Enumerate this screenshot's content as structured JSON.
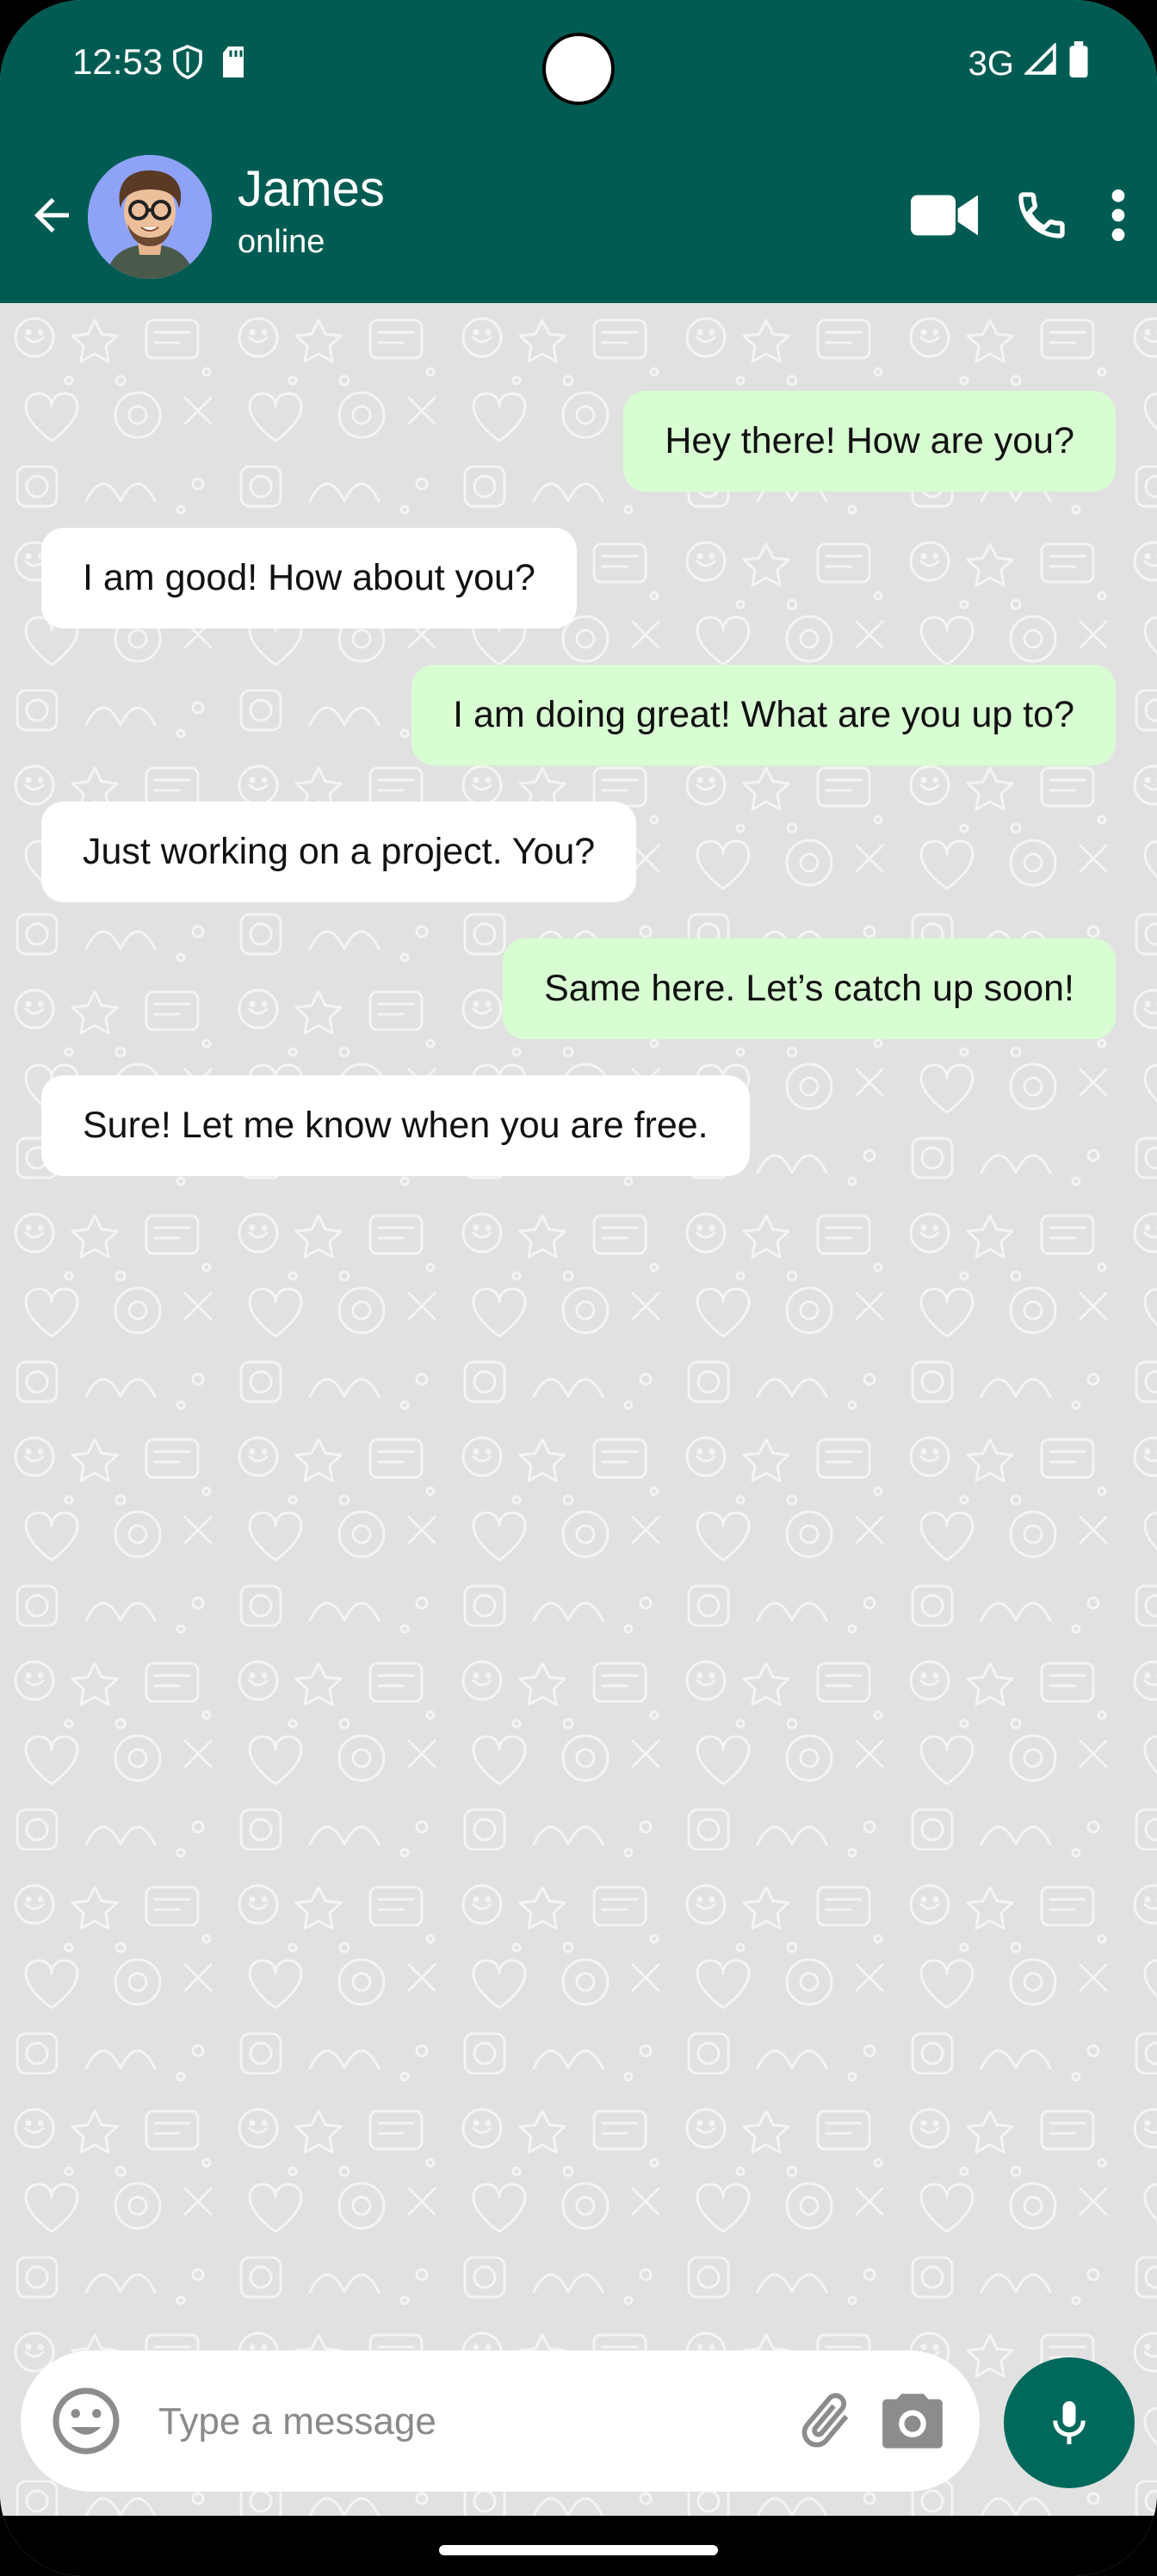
{
  "status": {
    "time": "12:53",
    "network": "3G",
    "icons": [
      "shield-icon",
      "sd-card-icon",
      "signal-icon",
      "battery-icon"
    ]
  },
  "header": {
    "name": "James",
    "status": "online",
    "actions": [
      "video-call-icon",
      "phone-call-icon",
      "more-vert-icon"
    ],
    "color": "#005c53"
  },
  "messages": [
    {
      "direction": "out",
      "text": "Hey there! How are you?"
    },
    {
      "direction": "in",
      "text": "I am good! How about you?"
    },
    {
      "direction": "out",
      "text": "I am doing great! What are you up to?"
    },
    {
      "direction": "in",
      "text": "Just working on a project. You?"
    },
    {
      "direction": "out",
      "text": "Same here. Let’s catch up soon!"
    },
    {
      "direction": "in",
      "text": "Sure! Let me know when you are free."
    }
  ],
  "composer": {
    "placeholder": "Type a message",
    "icons": [
      "emoji-icon",
      "attach-icon",
      "camera-icon",
      "mic-icon"
    ]
  },
  "colors": {
    "outgoing_bubble": "#d9fdd3",
    "incoming_bubble": "#ffffff",
    "chat_background": "#e1e1e1",
    "accent": "#00695c"
  }
}
